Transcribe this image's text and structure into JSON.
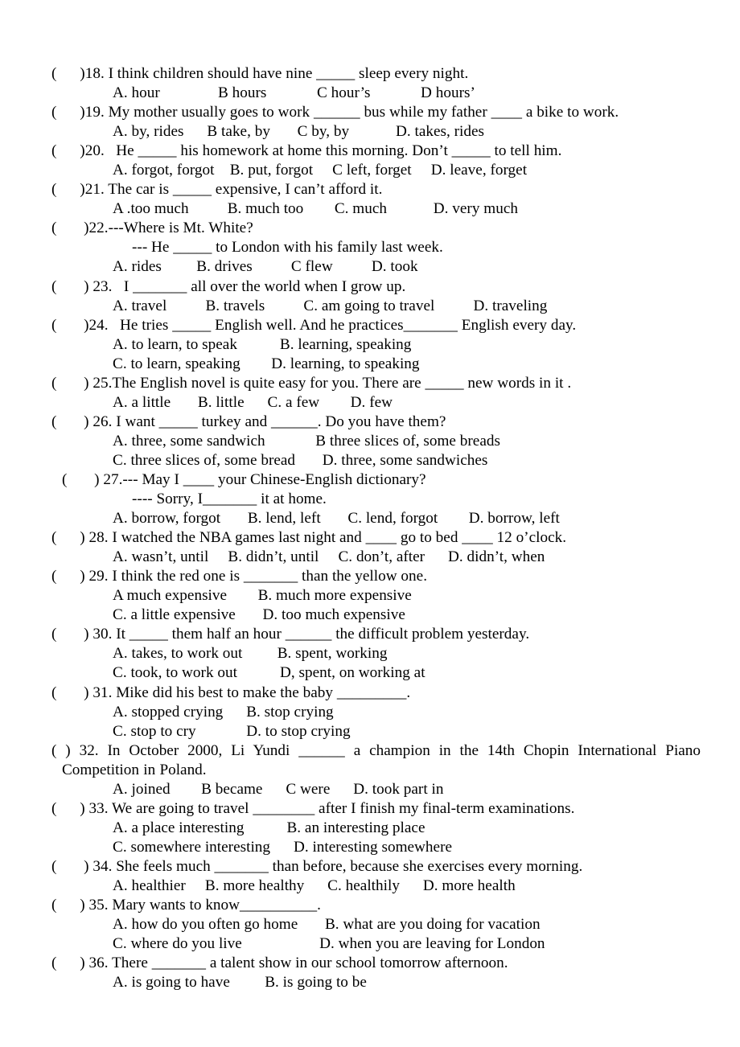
{
  "document": {
    "type": "english-multiple-choice-exam",
    "page_background": "#ffffff",
    "text_color": "#000000"
  },
  "questions": [
    {
      "marker": "(",
      "marker_close": ")",
      "number": "18.",
      "stem": "(      )18. I think children should have nine _____ sleep every night.",
      "option_lines": [
        "A. hour               B hours             C hour’s             D hours’"
      ]
    },
    {
      "marker": "(",
      "number": "19.",
      "stem": "(      )19. My mother usually goes to work ______ bus while my father ____ a bike to work.",
      "option_lines": [
        "A. by, rides      B take, by       C by, by            D. takes, rides"
      ]
    },
    {
      "marker": "(",
      "number": "20.",
      "stem": "(      )20.   He _____ his homework at home this morning. Don’t _____ to tell him.",
      "option_lines": [
        "A. forgot, forgot    B. put, forgot     C left, forget     D. leave, forget"
      ]
    },
    {
      "marker": "(",
      "number": "21.",
      "stem": "(      )21. The car is _____ expensive, I can’t afford it.",
      "option_lines": [
        "A .too much          B. much too        C. much            D. very much"
      ]
    },
    {
      "marker": "(",
      "number": "22.",
      "stem": "(       )22.---Where is Mt. White?",
      "sublines": [
        "--- He _____ to London with his family last week."
      ],
      "option_lines": [
        "A. rides         B. drives          C flew          D. took"
      ]
    },
    {
      "marker": "(",
      "number": "23.",
      "stem": "(       ) 23.   I _______ all over the world when I grow up.",
      "option_lines": [
        "A. travel          B. travels          C. am going to travel          D. traveling"
      ]
    },
    {
      "marker": "(",
      "number": "24.",
      "stem": "(       )24.   He tries _____ English well. And he practices_______ English every day.",
      "option_lines": [
        "A. to learn, to speak           B. learning, speaking",
        "C. to learn, speaking        D. learning, to speaking"
      ]
    },
    {
      "marker": "(",
      "number": "25.",
      "stem": "(       ) 25.The English novel is quite easy for you. There are _____ new words in it .",
      "option_lines": [
        "A. a little       B. little      C. a few        D. few"
      ]
    },
    {
      "marker": "(",
      "number": "26.",
      "stem": "(       ) 26. I want _____ turkey and ______. Do you have them?",
      "option_lines": [
        "A. three, some sandwich             B three slices of, some breads",
        "C. three slices of, some bread       D. three, some sandwiches"
      ]
    },
    {
      "marker": "(",
      "number": "27.",
      "stem": "(       ) 27.--- May I ____ your Chinese-English dictionary?",
      "indent": true,
      "sublines": [
        "---- Sorry, I_______ it at home."
      ],
      "option_lines": [
        "A. borrow, forgot       B. lend, left       C. lend, forgot        D. borrow, left"
      ]
    },
    {
      "marker": "(",
      "number": "28.",
      "stem": "(      ) 28. I watched the NBA games last night and ____ go to bed ____ 12 o’clock.",
      "option_lines": [
        "A. wasn’t, until     B. didn’t, until     C. don’t, after      D. didn’t, when"
      ]
    },
    {
      "marker": "(",
      "number": "29.",
      "stem": "(      ) 29. I think the red one is _______ than the yellow one.",
      "option_lines": [
        "A much expensive        B. much more expensive",
        "C. a little expensive       D. too much expensive"
      ]
    },
    {
      "marker": "(",
      "number": "30.",
      "stem": "(       ) 30. It _____ them half an hour ______ the difficult problem yesterday.",
      "option_lines": [
        "A. takes, to work out         B. spent, working",
        "C. took, to work out           D, spent, on working at"
      ]
    },
    {
      "marker": "(",
      "number": "31.",
      "stem": "(       ) 31. Mike did his best to make the baby _________.",
      "option_lines": [
        "A. stopped crying      B. stop crying",
        "C. stop to cry             D. to stop crying"
      ]
    },
    {
      "marker": "(",
      "number": "32.",
      "justified": true,
      "stem": "(        ) 32. In October 2000, Li Yundi ______ a champion in the 14th Chopin International Piano Competition in Poland.",
      "option_lines": [
        "A. joined        B became      C were      D. took part in"
      ]
    },
    {
      "marker": "(",
      "number": "33.",
      "stem": "(      ) 33. We are going to travel ________ after I finish my final-term examinations.",
      "option_lines": [
        "A. a place interesting           B. an interesting place",
        "C. somewhere interesting      D. interesting somewhere"
      ]
    },
    {
      "marker": "(",
      "number": "34.",
      "stem": "(       ) 34. She feels much _______ than before, because she exercises every morning.",
      "option_lines": [
        "A. healthier     B. more healthy      C. healthily      D. more health"
      ]
    },
    {
      "marker": "(",
      "number": "35.",
      "stem": "(      ) 35. Mary wants to know__________.",
      "option_lines": [
        "A. how do you often go home       B. what are you doing for vacation",
        "C. where do you live                    D. when you are leaving for London"
      ]
    },
    {
      "marker": "(",
      "number": "36.",
      "stem": "(      ) 36. There _______ a talent show in our school tomorrow afternoon.",
      "option_lines": [
        "A. is going to have         B. is going to be"
      ]
    }
  ]
}
